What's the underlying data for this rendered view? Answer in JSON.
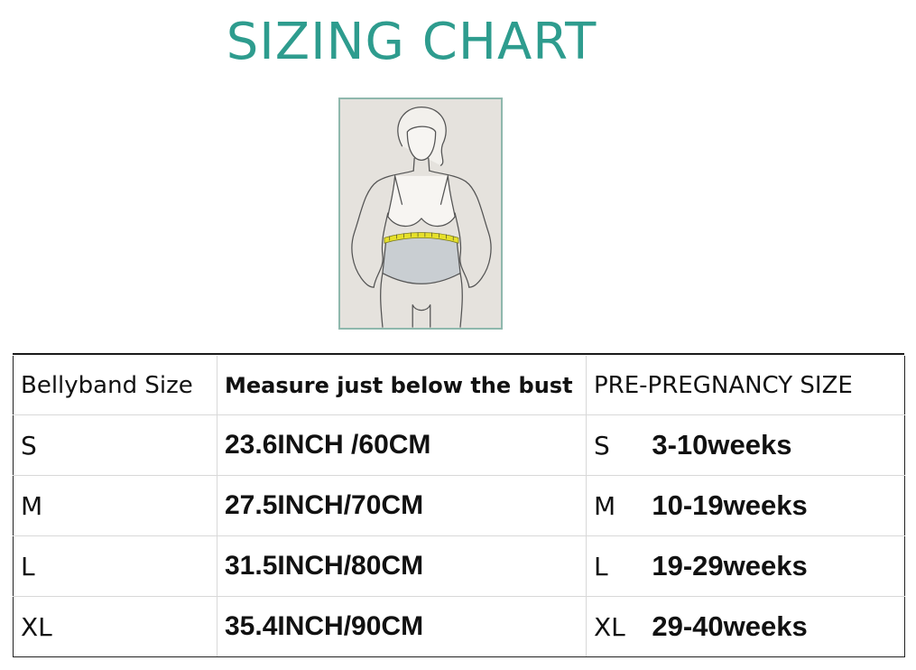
{
  "title": "SIZING CHART",
  "illustration": {
    "icon": "woman-measuring-waist-icon"
  },
  "table": {
    "headers": [
      "Bellyband Size",
      "Measure just below the bust",
      "PRE-PREGNANCY SIZE"
    ],
    "rows": [
      {
        "size": "S",
        "measure": "23.6INCH /60CM",
        "pre_size": "S",
        "weeks": "3-10weeks"
      },
      {
        "size": "M",
        "measure": "27.5INCH/70CM",
        "pre_size": "M",
        "weeks": "10-19weeks"
      },
      {
        "size": "L",
        "measure": "31.5INCH/80CM",
        "pre_size": "L",
        "weeks": "19-29weeks"
      },
      {
        "size": "XL",
        "measure": "35.4INCH/90CM",
        "pre_size": "XL",
        "weeks": "29-40weeks"
      }
    ]
  },
  "colors": {
    "title": "#2e9c8e",
    "figure_bg": "#e5e2dd",
    "tape": "#e6e02a"
  }
}
